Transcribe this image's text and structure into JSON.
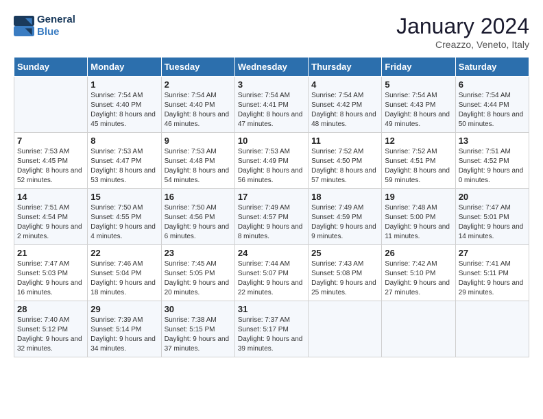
{
  "header": {
    "logo_general": "General",
    "logo_blue": "Blue",
    "title": "January 2024",
    "subtitle": "Creazzo, Veneto, Italy"
  },
  "columns": [
    "Sunday",
    "Monday",
    "Tuesday",
    "Wednesday",
    "Thursday",
    "Friday",
    "Saturday"
  ],
  "weeks": [
    [
      {
        "day": "",
        "sunrise": "",
        "sunset": "",
        "daylight": ""
      },
      {
        "day": "1",
        "sunrise": "Sunrise: 7:54 AM",
        "sunset": "Sunset: 4:40 PM",
        "daylight": "Daylight: 8 hours and 45 minutes."
      },
      {
        "day": "2",
        "sunrise": "Sunrise: 7:54 AM",
        "sunset": "Sunset: 4:40 PM",
        "daylight": "Daylight: 8 hours and 46 minutes."
      },
      {
        "day": "3",
        "sunrise": "Sunrise: 7:54 AM",
        "sunset": "Sunset: 4:41 PM",
        "daylight": "Daylight: 8 hours and 47 minutes."
      },
      {
        "day": "4",
        "sunrise": "Sunrise: 7:54 AM",
        "sunset": "Sunset: 4:42 PM",
        "daylight": "Daylight: 8 hours and 48 minutes."
      },
      {
        "day": "5",
        "sunrise": "Sunrise: 7:54 AM",
        "sunset": "Sunset: 4:43 PM",
        "daylight": "Daylight: 8 hours and 49 minutes."
      },
      {
        "day": "6",
        "sunrise": "Sunrise: 7:54 AM",
        "sunset": "Sunset: 4:44 PM",
        "daylight": "Daylight: 8 hours and 50 minutes."
      }
    ],
    [
      {
        "day": "7",
        "sunrise": "Sunrise: 7:53 AM",
        "sunset": "Sunset: 4:45 PM",
        "daylight": "Daylight: 8 hours and 52 minutes."
      },
      {
        "day": "8",
        "sunrise": "Sunrise: 7:53 AM",
        "sunset": "Sunset: 4:47 PM",
        "daylight": "Daylight: 8 hours and 53 minutes."
      },
      {
        "day": "9",
        "sunrise": "Sunrise: 7:53 AM",
        "sunset": "Sunset: 4:48 PM",
        "daylight": "Daylight: 8 hours and 54 minutes."
      },
      {
        "day": "10",
        "sunrise": "Sunrise: 7:53 AM",
        "sunset": "Sunset: 4:49 PM",
        "daylight": "Daylight: 8 hours and 56 minutes."
      },
      {
        "day": "11",
        "sunrise": "Sunrise: 7:52 AM",
        "sunset": "Sunset: 4:50 PM",
        "daylight": "Daylight: 8 hours and 57 minutes."
      },
      {
        "day": "12",
        "sunrise": "Sunrise: 7:52 AM",
        "sunset": "Sunset: 4:51 PM",
        "daylight": "Daylight: 8 hours and 59 minutes."
      },
      {
        "day": "13",
        "sunrise": "Sunrise: 7:51 AM",
        "sunset": "Sunset: 4:52 PM",
        "daylight": "Daylight: 9 hours and 0 minutes."
      }
    ],
    [
      {
        "day": "14",
        "sunrise": "Sunrise: 7:51 AM",
        "sunset": "Sunset: 4:54 PM",
        "daylight": "Daylight: 9 hours and 2 minutes."
      },
      {
        "day": "15",
        "sunrise": "Sunrise: 7:50 AM",
        "sunset": "Sunset: 4:55 PM",
        "daylight": "Daylight: 9 hours and 4 minutes."
      },
      {
        "day": "16",
        "sunrise": "Sunrise: 7:50 AM",
        "sunset": "Sunset: 4:56 PM",
        "daylight": "Daylight: 9 hours and 6 minutes."
      },
      {
        "day": "17",
        "sunrise": "Sunrise: 7:49 AM",
        "sunset": "Sunset: 4:57 PM",
        "daylight": "Daylight: 9 hours and 8 minutes."
      },
      {
        "day": "18",
        "sunrise": "Sunrise: 7:49 AM",
        "sunset": "Sunset: 4:59 PM",
        "daylight": "Daylight: 9 hours and 9 minutes."
      },
      {
        "day": "19",
        "sunrise": "Sunrise: 7:48 AM",
        "sunset": "Sunset: 5:00 PM",
        "daylight": "Daylight: 9 hours and 11 minutes."
      },
      {
        "day": "20",
        "sunrise": "Sunrise: 7:47 AM",
        "sunset": "Sunset: 5:01 PM",
        "daylight": "Daylight: 9 hours and 14 minutes."
      }
    ],
    [
      {
        "day": "21",
        "sunrise": "Sunrise: 7:47 AM",
        "sunset": "Sunset: 5:03 PM",
        "daylight": "Daylight: 9 hours and 16 minutes."
      },
      {
        "day": "22",
        "sunrise": "Sunrise: 7:46 AM",
        "sunset": "Sunset: 5:04 PM",
        "daylight": "Daylight: 9 hours and 18 minutes."
      },
      {
        "day": "23",
        "sunrise": "Sunrise: 7:45 AM",
        "sunset": "Sunset: 5:05 PM",
        "daylight": "Daylight: 9 hours and 20 minutes."
      },
      {
        "day": "24",
        "sunrise": "Sunrise: 7:44 AM",
        "sunset": "Sunset: 5:07 PM",
        "daylight": "Daylight: 9 hours and 22 minutes."
      },
      {
        "day": "25",
        "sunrise": "Sunrise: 7:43 AM",
        "sunset": "Sunset: 5:08 PM",
        "daylight": "Daylight: 9 hours and 25 minutes."
      },
      {
        "day": "26",
        "sunrise": "Sunrise: 7:42 AM",
        "sunset": "Sunset: 5:10 PM",
        "daylight": "Daylight: 9 hours and 27 minutes."
      },
      {
        "day": "27",
        "sunrise": "Sunrise: 7:41 AM",
        "sunset": "Sunset: 5:11 PM",
        "daylight": "Daylight: 9 hours and 29 minutes."
      }
    ],
    [
      {
        "day": "28",
        "sunrise": "Sunrise: 7:40 AM",
        "sunset": "Sunset: 5:12 PM",
        "daylight": "Daylight: 9 hours and 32 minutes."
      },
      {
        "day": "29",
        "sunrise": "Sunrise: 7:39 AM",
        "sunset": "Sunset: 5:14 PM",
        "daylight": "Daylight: 9 hours and 34 minutes."
      },
      {
        "day": "30",
        "sunrise": "Sunrise: 7:38 AM",
        "sunset": "Sunset: 5:15 PM",
        "daylight": "Daylight: 9 hours and 37 minutes."
      },
      {
        "day": "31",
        "sunrise": "Sunrise: 7:37 AM",
        "sunset": "Sunset: 5:17 PM",
        "daylight": "Daylight: 9 hours and 39 minutes."
      },
      {
        "day": "",
        "sunrise": "",
        "sunset": "",
        "daylight": ""
      },
      {
        "day": "",
        "sunrise": "",
        "sunset": "",
        "daylight": ""
      },
      {
        "day": "",
        "sunrise": "",
        "sunset": "",
        "daylight": ""
      }
    ]
  ]
}
